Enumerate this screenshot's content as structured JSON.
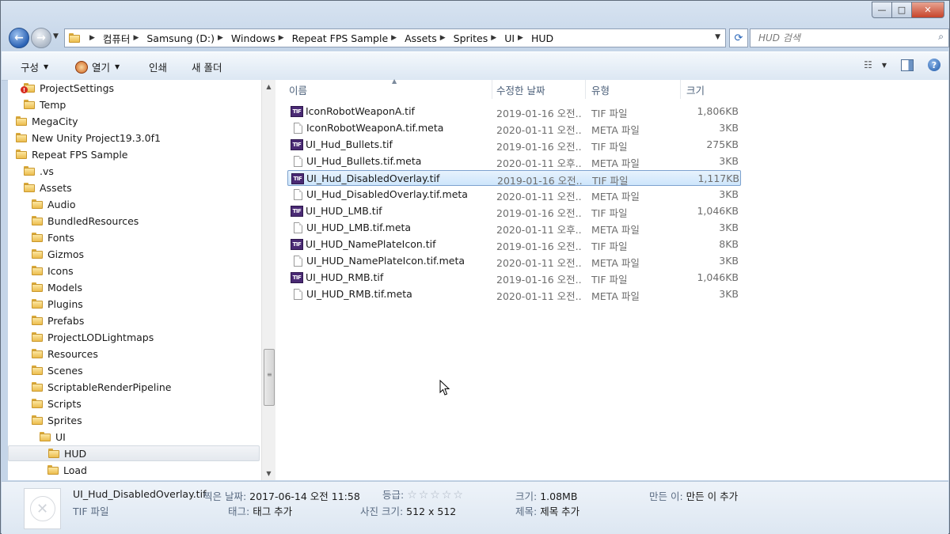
{
  "window": {
    "min": "—",
    "max": "□",
    "close": "✕"
  },
  "address": {
    "crumbs": [
      "컴퓨터",
      "Samsung (D:)",
      "Windows",
      "Repeat FPS Sample",
      "Assets",
      "Sprites",
      "UI",
      "HUD"
    ],
    "search_placeholder": "HUD 검색"
  },
  "toolbar": {
    "organize": "구성",
    "open": "열기",
    "print": "인쇄",
    "new_folder": "새 폴더"
  },
  "tree": [
    {
      "label": "ProjectSettings",
      "indent": 3,
      "warn": true
    },
    {
      "label": "Temp",
      "indent": 3
    },
    {
      "label": "MegaCity",
      "indent": 2
    },
    {
      "label": "New Unity Project19.3.0f1",
      "indent": 2
    },
    {
      "label": "Repeat FPS Sample",
      "indent": 2
    },
    {
      "label": ".vs",
      "indent": 3
    },
    {
      "label": "Assets",
      "indent": 3
    },
    {
      "label": "Audio",
      "indent": 4
    },
    {
      "label": "BundledResources",
      "indent": 4
    },
    {
      "label": "Fonts",
      "indent": 4
    },
    {
      "label": "Gizmos",
      "indent": 4
    },
    {
      "label": "Icons",
      "indent": 4
    },
    {
      "label": "Models",
      "indent": 4
    },
    {
      "label": "Plugins",
      "indent": 4
    },
    {
      "label": "Prefabs",
      "indent": 4
    },
    {
      "label": "ProjectLODLightmaps",
      "indent": 4
    },
    {
      "label": "Resources",
      "indent": 4
    },
    {
      "label": "Scenes",
      "indent": 4
    },
    {
      "label": "ScriptableRenderPipeline",
      "indent": 4
    },
    {
      "label": "Scripts",
      "indent": 4
    },
    {
      "label": "Sprites",
      "indent": 4
    },
    {
      "label": "UI",
      "indent": 5
    },
    {
      "label": "HUD",
      "indent": 6,
      "selected": true
    },
    {
      "label": "Load",
      "indent": 6
    }
  ],
  "columns": {
    "name": "이름",
    "date": "수정한 날짜",
    "type": "유형",
    "size": "크기"
  },
  "files": [
    {
      "name": "IconRobotWeaponA.tif",
      "date": "2019-01-16 오전...",
      "type": "TIF 파일",
      "size": "1,806KB",
      "icon": "tif"
    },
    {
      "name": "IconRobotWeaponA.tif.meta",
      "date": "2020-01-11 오전...",
      "type": "META 파일",
      "size": "3KB",
      "icon": "doc"
    },
    {
      "name": "UI_Hud_Bullets.tif",
      "date": "2019-01-16 오전...",
      "type": "TIF 파일",
      "size": "275KB",
      "icon": "tif"
    },
    {
      "name": "UI_Hud_Bullets.tif.meta",
      "date": "2020-01-11 오후...",
      "type": "META 파일",
      "size": "3KB",
      "icon": "doc"
    },
    {
      "name": "UI_Hud_DisabledOverlay.tif",
      "date": "2019-01-16 오전...",
      "type": "TIF 파일",
      "size": "1,117KB",
      "icon": "tif",
      "selected": true
    },
    {
      "name": "UI_Hud_DisabledOverlay.tif.meta",
      "date": "2020-01-11 오전...",
      "type": "META 파일",
      "size": "3KB",
      "icon": "doc"
    },
    {
      "name": "UI_HUD_LMB.tif",
      "date": "2019-01-16 오전...",
      "type": "TIF 파일",
      "size": "1,046KB",
      "icon": "tif"
    },
    {
      "name": "UI_HUD_LMB.tif.meta",
      "date": "2020-01-11 오후...",
      "type": "META 파일",
      "size": "3KB",
      "icon": "doc"
    },
    {
      "name": "UI_HUD_NamePlateIcon.tif",
      "date": "2019-01-16 오전...",
      "type": "TIF 파일",
      "size": "8KB",
      "icon": "tif"
    },
    {
      "name": "UI_HUD_NamePlateIcon.tif.meta",
      "date": "2020-01-11 오전...",
      "type": "META 파일",
      "size": "3KB",
      "icon": "doc"
    },
    {
      "name": "UI_HUD_RMB.tif",
      "date": "2019-01-16 오전...",
      "type": "TIF 파일",
      "size": "1,046KB",
      "icon": "tif"
    },
    {
      "name": "UI_HUD_RMB.tif.meta",
      "date": "2020-01-11 오전...",
      "type": "META 파일",
      "size": "3KB",
      "icon": "doc"
    }
  ],
  "details": {
    "filename": "UI_Hud_DisabledOverlay.tif",
    "filetype": "TIF 파일",
    "date_label": "찍은 날짜:",
    "date_value": "2017-06-14 오전 11:58",
    "tags_label": "태그:",
    "tags_value": "태그 추가",
    "rating_label": "등급:",
    "rating_stars": "☆☆☆☆☆",
    "dims_label": "사진 크기:",
    "dims_value": "512 x 512",
    "size_label": "크기:",
    "size_value": "1.08MB",
    "title_label": "제목:",
    "title_value": "제목 추가",
    "author_label": "만든 이:",
    "author_value": "만든 이 추가"
  },
  "tif_icon_text": "TIF"
}
